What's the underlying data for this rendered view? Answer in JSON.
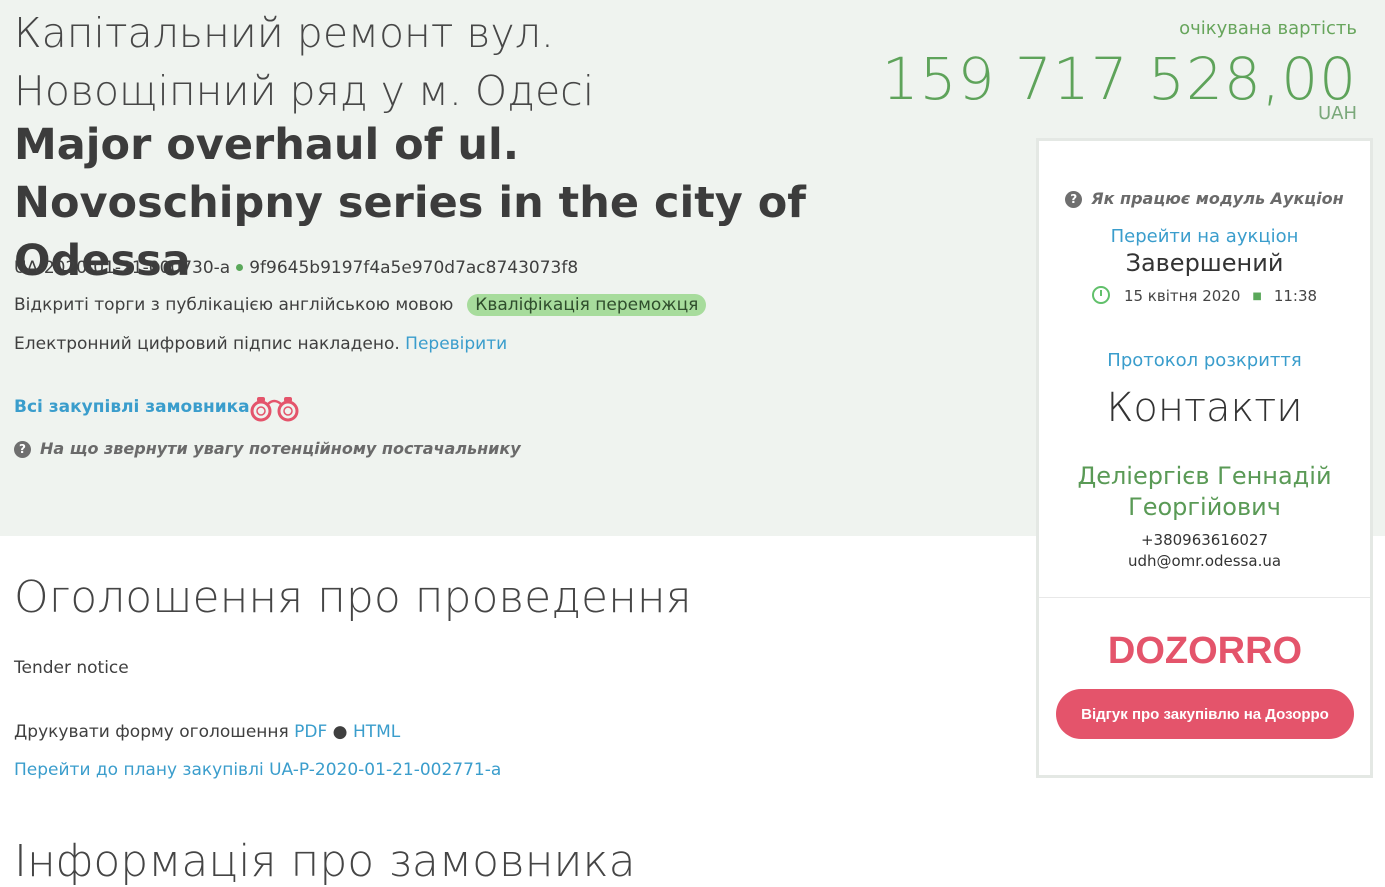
{
  "tender": {
    "title_uk": "Капітальний ремонт вул. Новощіпний ряд у м. Одесі",
    "title_en": "Major overhaul of ul. Novoschipny series in the city of Odessa",
    "id": "UA-2020-01-21-000730-a",
    "hash": "9f9645b9197f4a5e970d7ac8743073f8",
    "procedure": "Відкриті торги з публікацією англійською мовою",
    "status_badge": "Кваліфікація переможця",
    "signature_text": "Електронний цифровий підпис накладено.",
    "signature_link": "Перевірити",
    "all_procurements": "Всі закупівлі замовника",
    "supplier_hint": "На що звернути увагу потенційному постачальнику"
  },
  "expected": {
    "label": "очікувана вартість",
    "value": "159 717 528,00",
    "currency": "UAH"
  },
  "card": {
    "auction_hint": "Як працює модуль Аукціон",
    "auction_link": "Перейти на аукціон",
    "auction_status": "Завершений",
    "date": "15 квітня 2020",
    "time": "11:38",
    "protocol": "Протокол розкриття",
    "contacts_title": "Контакти",
    "contact_name": "Деліергієв Геннадій Георгійович",
    "phone": "+380963616027",
    "email": "udh@omr.odessa.ua",
    "dozorro_logo": "DOZORRO",
    "dozorro_button": "Відгук про закупівлю на Дозорро"
  },
  "notice": {
    "section_title": "Оголошення про проведення",
    "label": "Tender notice",
    "print_text": "Друкувати форму оголошення",
    "pdf": "PDF",
    "html": "HTML",
    "plan_link": "Перейти до плану закупівлі UA-P-2020-01-21-002771-a",
    "next_section_title": "Інформація про замовника"
  },
  "colors": {
    "hero_bg": "#eff3ef",
    "accent_green": "#5ea35a",
    "link_blue": "#3a9dcc",
    "dozorro_red": "#e4546b"
  }
}
